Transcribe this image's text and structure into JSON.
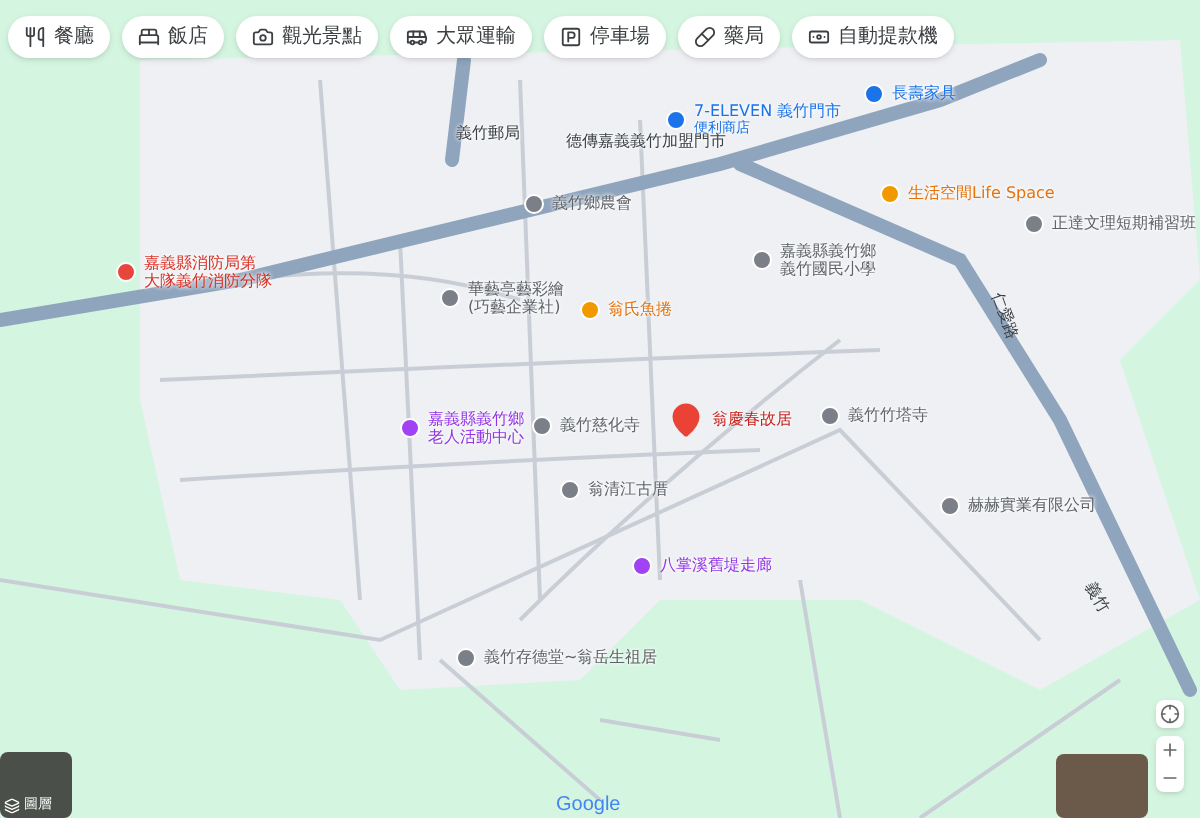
{
  "chips": [
    {
      "kind": "restaurant",
      "label": "餐廳"
    },
    {
      "kind": "hotel",
      "label": "飯店"
    },
    {
      "kind": "attraction",
      "label": "觀光景點"
    },
    {
      "kind": "transit",
      "label": "大眾運輸"
    },
    {
      "kind": "parking",
      "label": "停車場"
    },
    {
      "kind": "pharmacy",
      "label": "藥局"
    },
    {
      "kind": "atm",
      "label": "自動提款機"
    }
  ],
  "places": [
    {
      "kind": "shop",
      "lines": [
        "7-ELEVEN 義竹門市",
        "便利商店"
      ]
    },
    {
      "kind": "shop",
      "lines": [
        "長壽家具"
      ]
    },
    {
      "kind": "plain",
      "lines": [
        "德傳嘉義義竹加盟門市"
      ]
    },
    {
      "kind": "plain",
      "lines": [
        "義竹郵局"
      ]
    },
    {
      "kind": "poi",
      "lines": [
        "義竹鄉農會"
      ]
    },
    {
      "kind": "food",
      "lines": [
        "生活空間Life Space"
      ]
    },
    {
      "kind": "poi",
      "lines": [
        "正達文理短期補習班"
      ]
    },
    {
      "kind": "poi",
      "lines": [
        "嘉義縣義竹鄉",
        "義竹國民小學"
      ]
    },
    {
      "kind": "civic",
      "lines": [
        "嘉義縣消防局第",
        "大隊義竹消防分隊"
      ]
    },
    {
      "kind": "poi",
      "lines": [
        "華藝亭藝彩繪",
        "(巧藝企業社)"
      ]
    },
    {
      "kind": "food",
      "lines": [
        "翁氏魚捲"
      ]
    },
    {
      "kind": "venue",
      "lines": [
        "嘉義縣義竹鄉",
        "老人活動中心"
      ]
    },
    {
      "kind": "temple",
      "lines": [
        "義竹慈化寺"
      ]
    },
    {
      "kind": "pin",
      "lines": [
        "翁慶春故居"
      ]
    },
    {
      "kind": "temple",
      "lines": [
        "義竹竹塔寺"
      ]
    },
    {
      "kind": "poi",
      "lines": [
        "翁清江古厝"
      ]
    },
    {
      "kind": "poi",
      "lines": [
        "赫赫實業有限公司"
      ]
    },
    {
      "kind": "venue",
      "lines": [
        "八掌溪舊堤走廊"
      ]
    },
    {
      "kind": "poi",
      "lines": [
        "義竹存德堂~翁岳生祖居"
      ]
    }
  ],
  "road_labels": [
    "仁愛路",
    "義竹"
  ],
  "layers_label": "圖層",
  "logo": "Google"
}
